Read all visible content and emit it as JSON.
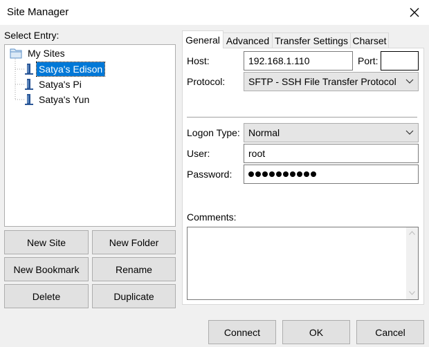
{
  "window": {
    "title": "Site Manager"
  },
  "left": {
    "select_entry_label": "Select Entry:",
    "tree": {
      "root": "My Sites",
      "items": [
        "Satya's Edison",
        "Satya's Pi",
        "Satya's Yun"
      ],
      "selected_index": 0
    },
    "buttons": {
      "new_site": "New Site",
      "new_folder": "New Folder",
      "new_bookmark": "New Bookmark",
      "rename": "Rename",
      "delete": "Delete",
      "duplicate": "Duplicate"
    }
  },
  "tabs": [
    "General",
    "Advanced",
    "Transfer Settings",
    "Charset"
  ],
  "general": {
    "host_label": "Host:",
    "host_value": "192.168.1.110",
    "port_label": "Port:",
    "port_value": "",
    "protocol_label": "Protocol:",
    "protocol_value": "SFTP - SSH File Transfer Protocol",
    "logon_type_label": "Logon Type:",
    "logon_type_value": "Normal",
    "user_label": "User:",
    "user_value": "root",
    "password_label": "Password:",
    "password_length": 10,
    "comments_label": "Comments:"
  },
  "footer": {
    "connect": "Connect",
    "ok": "OK",
    "cancel": "Cancel"
  }
}
